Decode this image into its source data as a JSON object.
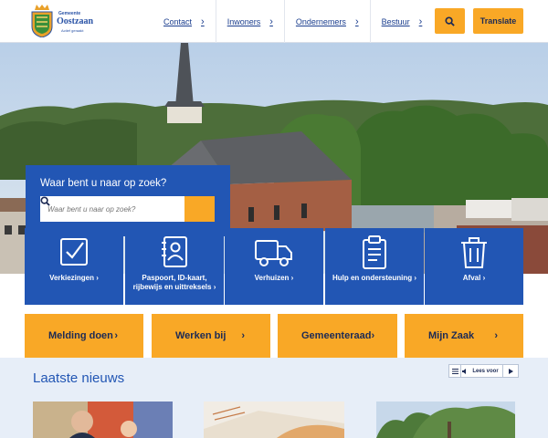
{
  "header": {
    "logo": {
      "org_top": "Gemeente",
      "name": "Oostzaan",
      "tagline": "Actief geraakt"
    },
    "nav": [
      {
        "label": "Contact"
      },
      {
        "label": "Inwoners"
      },
      {
        "label": "Ondernemers"
      },
      {
        "label": "Bestuur"
      }
    ],
    "search_icon": "search-icon",
    "translate_label": "Translate"
  },
  "search": {
    "title": "Waar bent u naar op zoek?",
    "placeholder": "Waar bent u naar op zoek?"
  },
  "services": [
    {
      "label": "Verkiezingen",
      "icon": "checkbox-icon"
    },
    {
      "label": "Paspoort, ID-kaart, rijbewijs en uittreksels",
      "icon": "id-card-icon"
    },
    {
      "label": "Verhuizen",
      "icon": "truck-icon"
    },
    {
      "label": "Hulp en ondersteuning",
      "icon": "clipboard-icon"
    },
    {
      "label": "Afval",
      "icon": "trash-icon"
    }
  ],
  "quick_links": [
    {
      "label": "Melding doen"
    },
    {
      "label": "Werken bij"
    },
    {
      "label": "Gemeenteraad"
    },
    {
      "label": "Mijn Zaak"
    }
  ],
  "news": {
    "title": "Laatste nieuws",
    "read_aloud_label": "Lees voor"
  },
  "colors": {
    "primary_blue": "#2256b4",
    "accent_orange": "#f9a826",
    "news_bg": "#e7eef8"
  }
}
